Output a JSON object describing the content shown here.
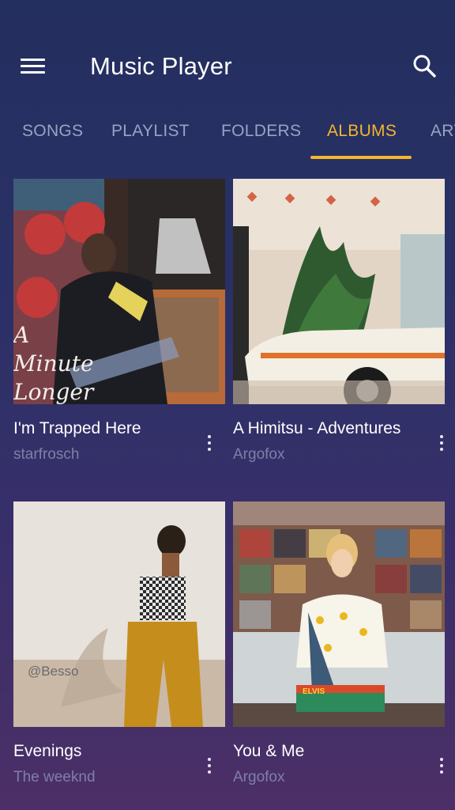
{
  "header": {
    "title": "Music Player",
    "menu_icon": "hamburger-menu-icon",
    "search_icon": "search-icon"
  },
  "tabs": [
    {
      "label": "SONGS",
      "active": false
    },
    {
      "label": "PLAYLIST",
      "active": false
    },
    {
      "label": "FOLDERS",
      "active": false
    },
    {
      "label": "ALBUMS",
      "active": true
    },
    {
      "label": "ARTISTS",
      "active": false
    }
  ],
  "colors": {
    "accent": "#f5b52c",
    "tab_inactive": "#9aa2c4",
    "artist_text": "#7f7fa8",
    "bg_top": "#232f5f",
    "bg_bottom": "#4c2f66"
  },
  "albums": [
    {
      "title": "I'm Trapped Here",
      "artist": "starfrosch",
      "cover_text": "A Minute Longer"
    },
    {
      "title": "A Himitsu - Adventures",
      "artist": "Argofox"
    },
    {
      "title": "Evenings",
      "artist": "The weeknd",
      "cover_text": "@Besso"
    },
    {
      "title": "You & Me",
      "artist": "Argofox",
      "cover_text": "ELVIS"
    }
  ]
}
